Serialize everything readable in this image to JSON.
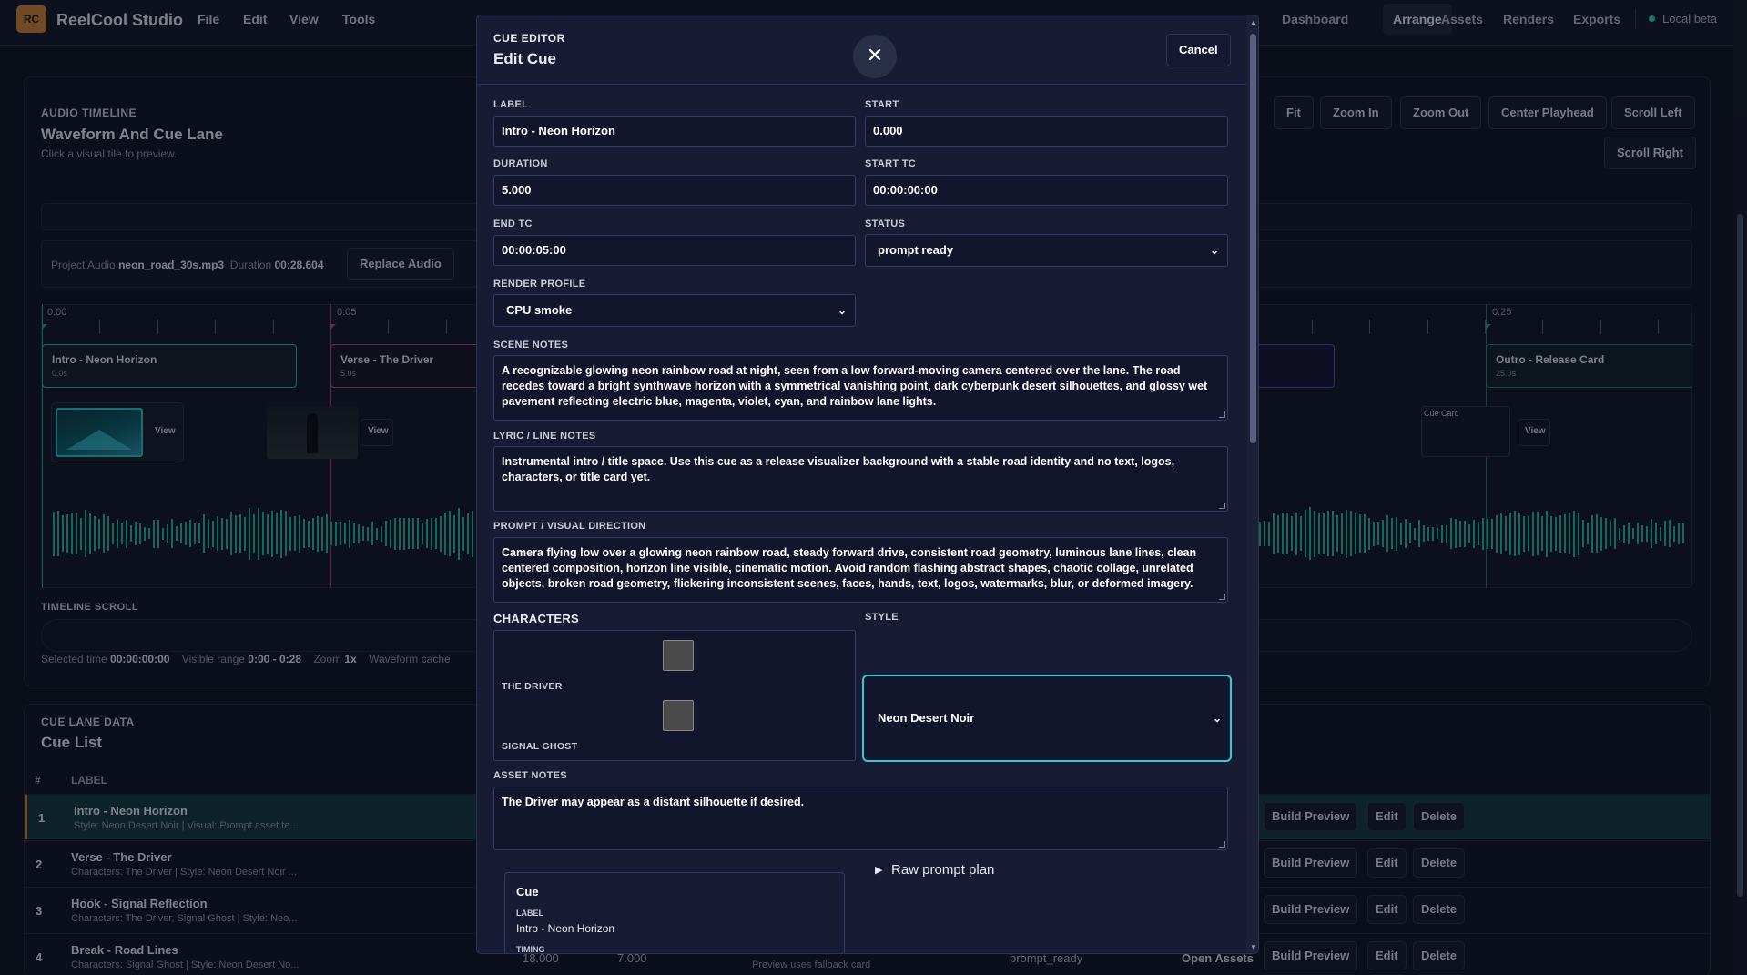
{
  "app": {
    "logo": "RC",
    "title": "ReelCool Studio"
  },
  "menu": [
    "File",
    "Edit",
    "View",
    "Tools"
  ],
  "nav": {
    "tabs": [
      "Dashboard",
      "Arrange",
      "Assets",
      "Renders",
      "Exports"
    ],
    "active": "Arrange",
    "status": "Local beta"
  },
  "timeline": {
    "kicker": "AUDIO TIMELINE",
    "title": "Waveform And Cue Lane",
    "hint": "Click a visual tile to preview.",
    "buttons": [
      "Fit",
      "Zoom In",
      "Zoom Out",
      "Center Playhead",
      "Scroll Left",
      "Scroll Right"
    ],
    "audio": {
      "prefix": "Project Audio",
      "file": "neon_road_30s.mp3",
      "duration_label": "Duration",
      "duration": "00:28.604",
      "replace_button": "Replace Audio"
    },
    "ruler": [
      "0:00",
      "0:05",
      "0:25"
    ],
    "cues": [
      {
        "title": "Intro - Neon Horizon",
        "sub": "0.0s"
      },
      {
        "title": "Verse - The Driver",
        "sub": "5.0s"
      },
      {
        "title": "Outro - Release Card",
        "sub": "25.0s"
      }
    ],
    "thumb_view": "View",
    "cue_card_label": "Cue Card",
    "scroll_label": "TIMELINE SCROLL",
    "footer": {
      "selected_label": "Selected time",
      "selected": "00:00:00:00",
      "range_label": "Visible range",
      "range": "0:00 - 0:28",
      "zoom_label": "Zoom",
      "zoom": "1x",
      "cache": "Waveform cache"
    }
  },
  "cuelist": {
    "kicker": "CUE LANE DATA",
    "title": "Cue List",
    "headers": [
      "#",
      "LABEL"
    ],
    "rows": [
      {
        "num": "1",
        "title": "Intro - Neon Horizon",
        "sub": "Style: Neon Desert Noir | Visual: Prompt asset te..."
      },
      {
        "num": "2",
        "title": "Verse - The Driver",
        "sub": "Characters: The Driver | Style: Neon Desert Noir ..."
      },
      {
        "num": "3",
        "title": "Hook - Signal Reflection",
        "sub": "Characters: The Driver, Signal Ghost | Style: Neo..."
      },
      {
        "num": "4",
        "title": "Break - Road Lines",
        "sub": "Characters: Signal Ghost | Style: Neon Desert No..."
      }
    ],
    "row_actions": [
      "Build Preview",
      "Edit",
      "Delete"
    ],
    "row4_extra": {
      "start": "18.000",
      "dur": "7.000",
      "preview": "Preview uses fallback card",
      "status": "prompt_ready",
      "open_assets": "Open Assets"
    }
  },
  "modal": {
    "kicker": "CUE EDITOR",
    "title": "Edit Cue",
    "cancel": "Cancel",
    "fields": {
      "label": {
        "label": "LABEL",
        "value": "Intro - Neon Horizon"
      },
      "start": {
        "label": "START",
        "value": "0.000"
      },
      "duration": {
        "label": "DURATION",
        "value": "5.000"
      },
      "start_tc": {
        "label": "START TC",
        "value": "00:00:00:00"
      },
      "end_tc": {
        "label": "END TC",
        "value": "00:00:05:00"
      },
      "status": {
        "label": "STATUS",
        "value": "prompt ready"
      },
      "render_profile": {
        "label": "RENDER PROFILE",
        "value": "CPU smoke"
      },
      "scene_notes": {
        "label": "SCENE NOTES",
        "value": "A recognizable glowing neon rainbow road at night, seen from a low forward-moving camera centered over the lane. The road recedes toward a bright synthwave horizon with a symmetrical vanishing point, dark cyberpunk desert silhouettes, and glossy wet pavement reflecting electric blue, magenta, violet, cyan, and rainbow lane lights."
      },
      "lyric_notes": {
        "label": "LYRIC / LINE NOTES",
        "value": "Instrumental intro / title space. Use this cue as a release visualizer background with a stable road identity and no text, logos, characters, or title card yet."
      },
      "prompt": {
        "label": "PROMPT / VISUAL DIRECTION",
        "value": "Camera flying low over a glowing neon rainbow road, steady forward drive, consistent road geometry, luminous lane lines, clean centered composition, horizon line visible, cinematic motion. Avoid random flashing abstract shapes, chaotic collage, unrelated objects, broken road geometry, flickering inconsistent scenes, faces, hands, text, logos, watermarks, blur, or deformed imagery."
      },
      "characters": {
        "label": "CHARACTERS",
        "items": [
          "THE DRIVER",
          "SIGNAL GHOST"
        ]
      },
      "style": {
        "label": "STYLE",
        "value": "Neon Desert Noir"
      },
      "asset_notes": {
        "label": "ASSET NOTES",
        "value": "The Driver may appear as a distant silhouette if desired."
      }
    },
    "raw_plan": "Raw prompt plan",
    "summary": {
      "title": "Cue",
      "label_heading": "LABEL",
      "label_value": "Intro - Neon Horizon",
      "timing_heading": "TIMING"
    }
  },
  "colors": {
    "accent": "#2bd3a3",
    "magenta": "#d0477f",
    "modal_bg": "#171b34",
    "focus": "#35c9d8"
  }
}
